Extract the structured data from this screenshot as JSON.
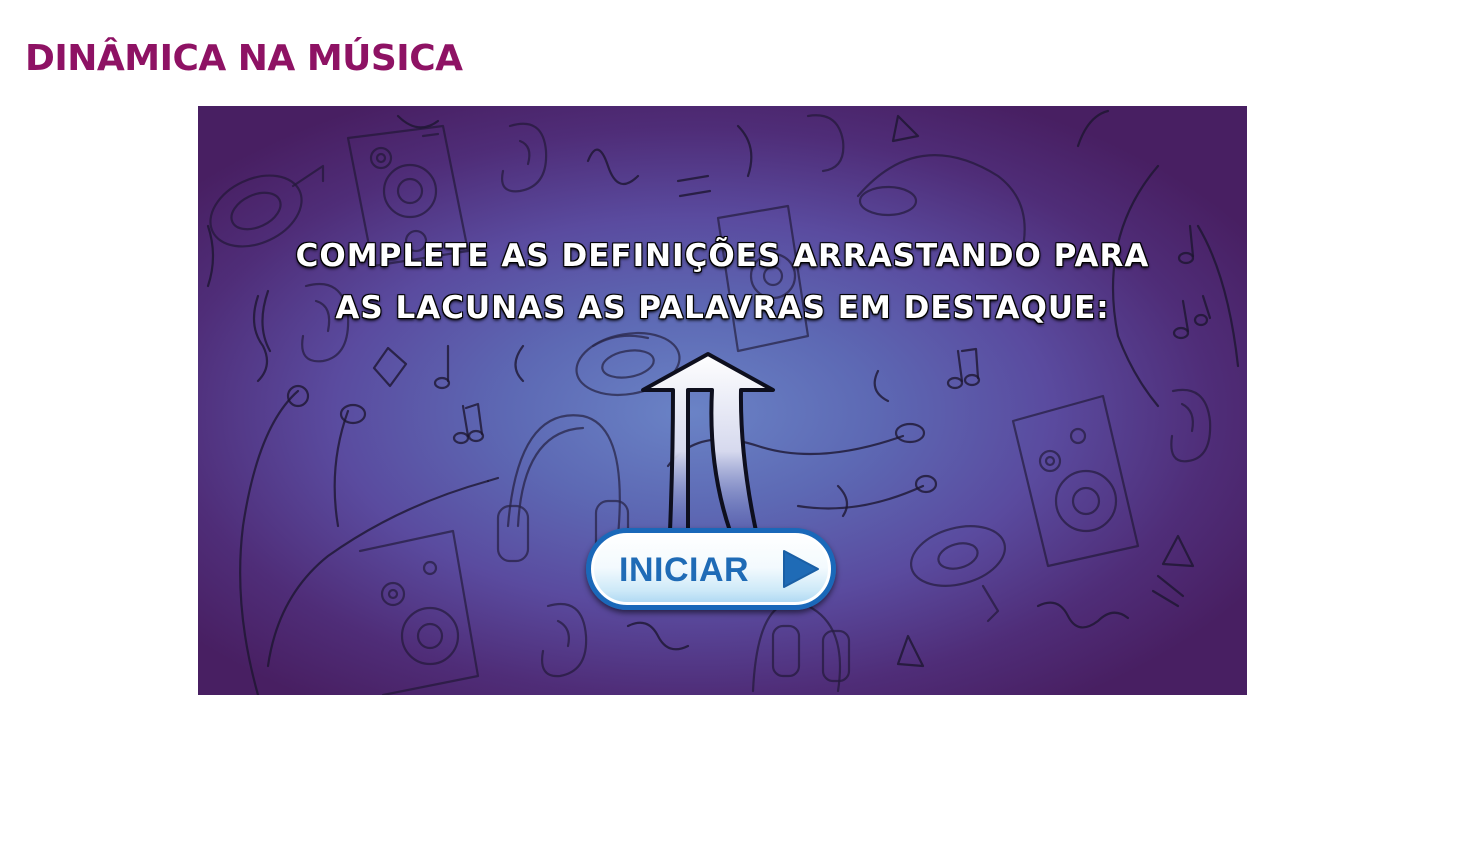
{
  "page": {
    "title": "DINÂMICA NA MÚSICA"
  },
  "activity": {
    "instruction_line1": "COMPLETE AS DEFINIÇÕES ARRASTANDO PARA",
    "instruction_line2": "AS LACUNAS AS PALAVRAS EM DESTAQUE:",
    "start_button_label": "INICIAR",
    "arrow_icon": "up-arrow-icon",
    "play_icon": "play-icon",
    "background_theme": "music-doodles: speakers, headphones, ears, music notes"
  },
  "colors": {
    "title": "#8e1264",
    "background_center": "#6a83c6",
    "background_edge": "#481f62",
    "button_text": "#1f6bb6",
    "button_border": "#1a68b9"
  }
}
